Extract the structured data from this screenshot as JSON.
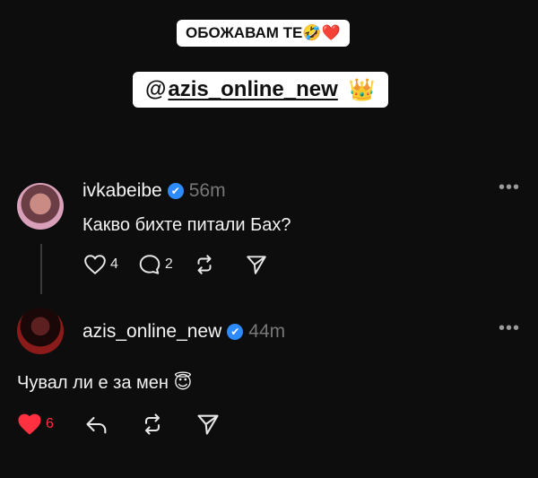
{
  "stickers": {
    "top_text": "ОБОЖАВАМ ТЕ",
    "top_emojis": "🤣❤️",
    "handle_logo": "@",
    "handle": "azis_online_new",
    "handle_emoji": "👑"
  },
  "posts": [
    {
      "username": "ivkabeibe",
      "time": "56m",
      "text": "Какво бихте питали Бах?",
      "likes": "4",
      "replies": "2",
      "more": "•••"
    },
    {
      "username": "azis_online_new",
      "time": "44m",
      "text": "Чувал ли е за мен",
      "text_emoji": "😇",
      "likes": "6",
      "liked": true,
      "more": "•••"
    }
  ],
  "icons": {
    "verified": "✔",
    "like": "heart-icon",
    "reply": "comment-icon",
    "repost": "repost-icon",
    "share": "send-icon"
  },
  "colors": {
    "background": "#0d0d0d",
    "verified": "#2e8bff",
    "liked": "#ff3040",
    "muted": "#777777"
  }
}
